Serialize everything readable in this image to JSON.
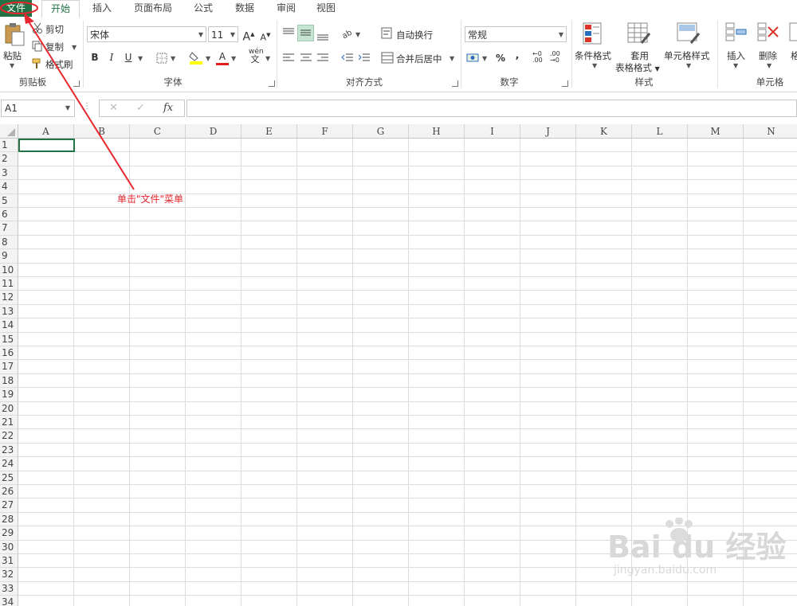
{
  "tabs": [
    {
      "label": "文件",
      "state": "file"
    },
    {
      "label": "开始",
      "state": "active"
    },
    {
      "label": "插入",
      "state": ""
    },
    {
      "label": "页面布局",
      "state": ""
    },
    {
      "label": "公式",
      "state": ""
    },
    {
      "label": "数据",
      "state": ""
    },
    {
      "label": "审阅",
      "state": ""
    },
    {
      "label": "视图",
      "state": ""
    }
  ],
  "clipboard": {
    "paste": "粘贴",
    "cut": "剪切",
    "copy": "复制",
    "format_painter": "格式刷",
    "group": "剪贴板"
  },
  "font": {
    "name": "宋体",
    "size": "11",
    "bold": "B",
    "italic": "I",
    "underline": "U",
    "phonetic": "wén",
    "phonetic_char": "文",
    "grow": "A",
    "shrink": "A",
    "color_letter": "A",
    "group": "字体"
  },
  "alignment": {
    "wrap": "自动换行",
    "merge": "合并后居中",
    "group": "对齐方式"
  },
  "number": {
    "format": "常规",
    "percent": "%",
    "comma": ",",
    "inc": ".00",
    "dec": ".00",
    "group": "数字"
  },
  "styles": {
    "conditional": "条件格式",
    "table_line1": "套用",
    "table_line2": "表格格式",
    "cell_styles": "单元格样式",
    "group": "样式"
  },
  "cells": {
    "insert": "插入",
    "delete": "删除",
    "format": "格",
    "group": "单元格"
  },
  "formula_bar": {
    "name_box": "A1",
    "cancel": "✕",
    "enter": "✓",
    "fx": "fx"
  },
  "columns": [
    "A",
    "B",
    "C",
    "D",
    "E",
    "F",
    "G",
    "H",
    "I",
    "J",
    "K",
    "L",
    "M",
    "N"
  ],
  "rows": [
    "1",
    "2",
    "3",
    "4",
    "5",
    "6",
    "7",
    "8",
    "9",
    "10",
    "11",
    "12",
    "13",
    "14",
    "15",
    "16",
    "17",
    "18",
    "19",
    "20",
    "21",
    "22",
    "23",
    "24",
    "25",
    "26",
    "27",
    "28",
    "29",
    "30",
    "31",
    "32",
    "33",
    "34"
  ],
  "annotation": "单击\"文件\"菜单",
  "watermark": {
    "main": "Bai du 经验",
    "url": "jingyan.baidu.com"
  },
  "colors": {
    "accent": "#217346",
    "annotation": "#e8262d"
  }
}
